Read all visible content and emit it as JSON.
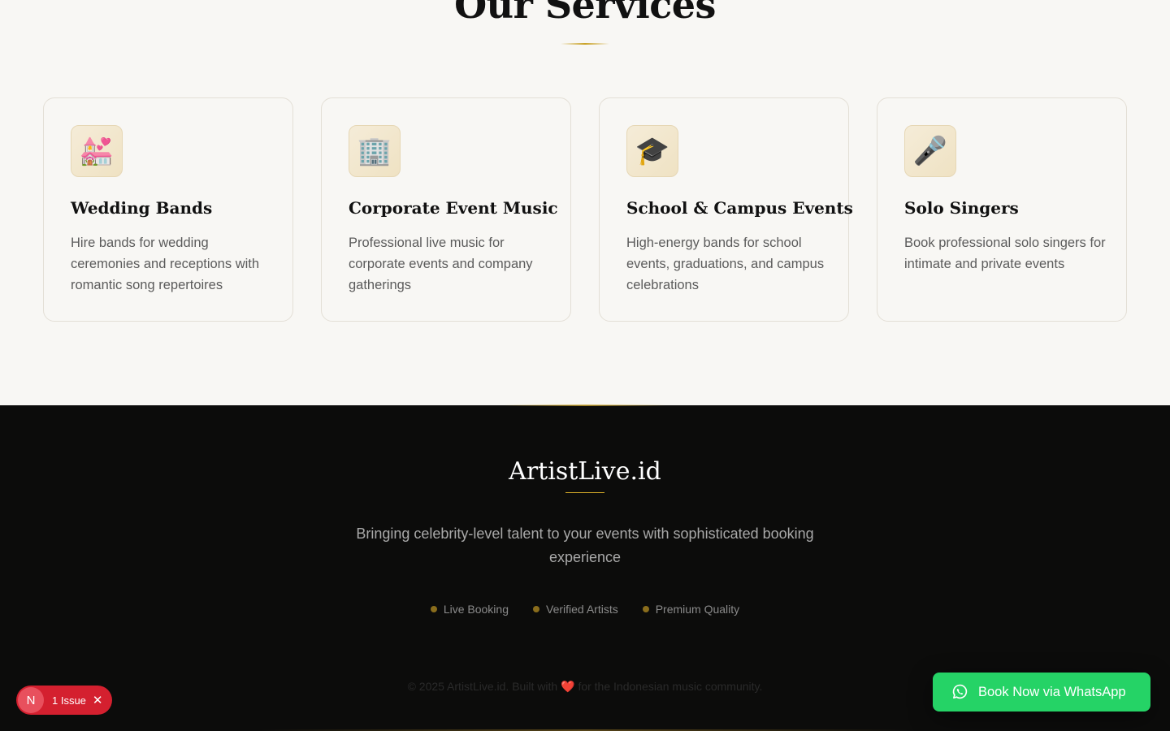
{
  "services": {
    "title": "Our Services",
    "cards": [
      {
        "icon": "💒",
        "icon_name": "wedding-chapel-icon",
        "title": "Wedding Bands",
        "description": "Hire bands for wedding ceremonies and receptions with romantic song repertoires"
      },
      {
        "icon": "🏢",
        "icon_name": "office-building-icon",
        "title": "Corporate Event Music",
        "description": "Professional live music for corporate events and company gatherings"
      },
      {
        "icon": "🎓",
        "icon_name": "graduation-cap-icon",
        "title": "School & Campus Events",
        "description": "High-energy bands for school events, graduations, and campus celebrations"
      },
      {
        "icon": "🎤",
        "icon_name": "microphone-icon",
        "title": "Solo Singers",
        "description": "Book professional solo singers for intimate and private events"
      }
    ]
  },
  "footer": {
    "brand": "ArtistLive.id",
    "tagline": "Bringing celebrity-level talent to your events with sophisticated booking experience",
    "features": [
      "Live Booking",
      "Verified Artists",
      "Premium Quality"
    ],
    "copyright_before": "© 2025 ArtistLive.id. Built with",
    "heart": "❤️",
    "copyright_after": "for the Indonesian music community."
  },
  "issue_badge": {
    "letter": "N",
    "label": "1 Issue",
    "close": "✕"
  },
  "whatsapp_button": {
    "label": "Book Now via WhatsApp"
  },
  "colors": {
    "accent_gold": "#c9a227",
    "whatsapp_green": "#25d366",
    "issue_red": "#d4202f",
    "footer_bg": "#0c0c0b",
    "services_bg": "#f8f7f4"
  }
}
